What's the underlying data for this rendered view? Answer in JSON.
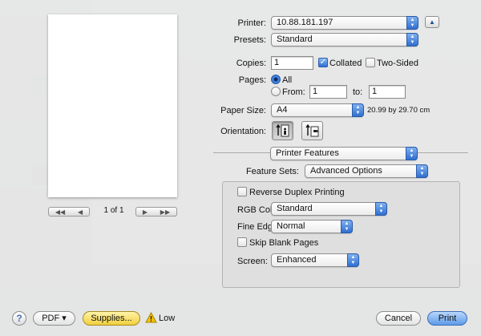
{
  "printer": {
    "label": "Printer:",
    "value": "10.88.181.197"
  },
  "presets": {
    "label": "Presets:",
    "value": "Standard"
  },
  "copies": {
    "label": "Copies:",
    "value": "1",
    "collated_label": "Collated",
    "collated": true,
    "two_sided_label": "Two-Sided",
    "two_sided": false
  },
  "pages": {
    "label": "Pages:",
    "all_label": "All",
    "from_label": "From:",
    "from_value": "1",
    "to_label": "to:",
    "to_value": "1",
    "selected": "all"
  },
  "paper_size": {
    "label": "Paper Size:",
    "value": "A4",
    "dimensions": "20.99 by 29.70 cm"
  },
  "orientation": {
    "label": "Orientation:",
    "selected": "portrait"
  },
  "panel_menu": {
    "value": "Printer Features"
  },
  "feature_sets": {
    "label": "Feature Sets:",
    "value": "Advanced Options"
  },
  "advanced": {
    "reverse_duplex_label": "Reverse Duplex Printing",
    "reverse_duplex": false,
    "rgb_color_label": "RGB Color:",
    "rgb_color_value": "Standard",
    "fine_edge_label": "Fine Edge:",
    "fine_edge_value": "Normal",
    "skip_blank_label": "Skip Blank Pages",
    "skip_blank": false,
    "screen_label": "Screen:",
    "screen_value": "Enhanced"
  },
  "preview": {
    "page_info": "1 of 1"
  },
  "footer": {
    "help": "?",
    "pdf_label": "PDF ▾",
    "supplies_label": "Supplies...",
    "supply_status": "Low",
    "cancel_label": "Cancel",
    "print_label": "Print"
  },
  "colors": {
    "accent": "#2f6fd0",
    "default_button": "#5d9be9",
    "supplies_button": "#f2cf3c",
    "warning": "#f5c400"
  }
}
